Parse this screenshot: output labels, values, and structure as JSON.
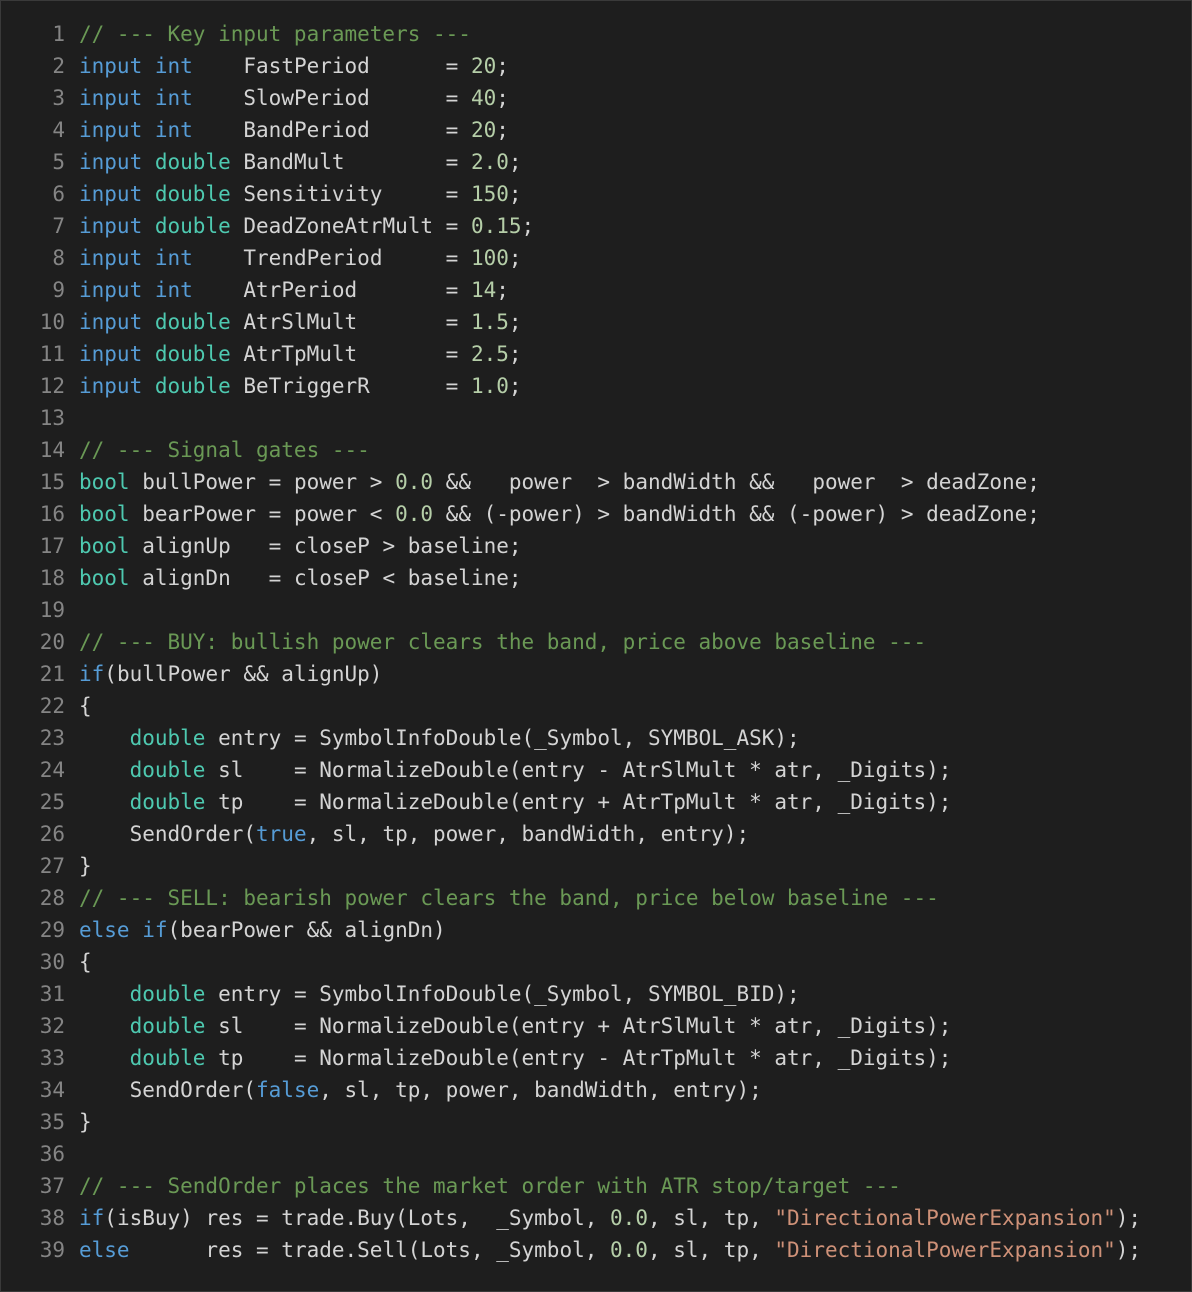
{
  "colors": {
    "background": "#1e1e1e",
    "line_number": "#858585",
    "comment": "#6a9955",
    "keyword": "#569cd6",
    "type": "#4ec9b0",
    "number": "#b5cea8",
    "string": "#ce9178",
    "plain": "#d4d4d4"
  },
  "lines": [
    {
      "number": "1",
      "tokens": [
        {
          "t": "comment",
          "v": "// --- Key input parameters ---"
        }
      ]
    },
    {
      "number": "2",
      "tokens": [
        {
          "t": "keyword",
          "v": "input"
        },
        {
          "t": "plain",
          "v": " "
        },
        {
          "t": "keyword",
          "v": "int"
        },
        {
          "t": "plain",
          "v": "    FastPeriod      = "
        },
        {
          "t": "number",
          "v": "20"
        },
        {
          "t": "plain",
          "v": ";"
        }
      ]
    },
    {
      "number": "3",
      "tokens": [
        {
          "t": "keyword",
          "v": "input"
        },
        {
          "t": "plain",
          "v": " "
        },
        {
          "t": "keyword",
          "v": "int"
        },
        {
          "t": "plain",
          "v": "    SlowPeriod      = "
        },
        {
          "t": "number",
          "v": "40"
        },
        {
          "t": "plain",
          "v": ";"
        }
      ]
    },
    {
      "number": "4",
      "tokens": [
        {
          "t": "keyword",
          "v": "input"
        },
        {
          "t": "plain",
          "v": " "
        },
        {
          "t": "keyword",
          "v": "int"
        },
        {
          "t": "plain",
          "v": "    BandPeriod      = "
        },
        {
          "t": "number",
          "v": "20"
        },
        {
          "t": "plain",
          "v": ";"
        }
      ]
    },
    {
      "number": "5",
      "tokens": [
        {
          "t": "keyword",
          "v": "input"
        },
        {
          "t": "plain",
          "v": " "
        },
        {
          "t": "type",
          "v": "double"
        },
        {
          "t": "plain",
          "v": " BandMult        = "
        },
        {
          "t": "number",
          "v": "2.0"
        },
        {
          "t": "plain",
          "v": ";"
        }
      ]
    },
    {
      "number": "6",
      "tokens": [
        {
          "t": "keyword",
          "v": "input"
        },
        {
          "t": "plain",
          "v": " "
        },
        {
          "t": "type",
          "v": "double"
        },
        {
          "t": "plain",
          "v": " Sensitivity     = "
        },
        {
          "t": "number",
          "v": "150"
        },
        {
          "t": "plain",
          "v": ";"
        }
      ]
    },
    {
      "number": "7",
      "tokens": [
        {
          "t": "keyword",
          "v": "input"
        },
        {
          "t": "plain",
          "v": " "
        },
        {
          "t": "type",
          "v": "double"
        },
        {
          "t": "plain",
          "v": " DeadZoneAtrMult = "
        },
        {
          "t": "number",
          "v": "0.15"
        },
        {
          "t": "plain",
          "v": ";"
        }
      ]
    },
    {
      "number": "8",
      "tokens": [
        {
          "t": "keyword",
          "v": "input"
        },
        {
          "t": "plain",
          "v": " "
        },
        {
          "t": "keyword",
          "v": "int"
        },
        {
          "t": "plain",
          "v": "    TrendPeriod     = "
        },
        {
          "t": "number",
          "v": "100"
        },
        {
          "t": "plain",
          "v": ";"
        }
      ]
    },
    {
      "number": "9",
      "tokens": [
        {
          "t": "keyword",
          "v": "input"
        },
        {
          "t": "plain",
          "v": " "
        },
        {
          "t": "keyword",
          "v": "int"
        },
        {
          "t": "plain",
          "v": "    AtrPeriod       = "
        },
        {
          "t": "number",
          "v": "14"
        },
        {
          "t": "plain",
          "v": ";"
        }
      ]
    },
    {
      "number": "10",
      "tokens": [
        {
          "t": "keyword",
          "v": "input"
        },
        {
          "t": "plain",
          "v": " "
        },
        {
          "t": "type",
          "v": "double"
        },
        {
          "t": "plain",
          "v": " AtrSlMult       = "
        },
        {
          "t": "number",
          "v": "1.5"
        },
        {
          "t": "plain",
          "v": ";"
        }
      ]
    },
    {
      "number": "11",
      "tokens": [
        {
          "t": "keyword",
          "v": "input"
        },
        {
          "t": "plain",
          "v": " "
        },
        {
          "t": "type",
          "v": "double"
        },
        {
          "t": "plain",
          "v": " AtrTpMult       = "
        },
        {
          "t": "number",
          "v": "2.5"
        },
        {
          "t": "plain",
          "v": ";"
        }
      ]
    },
    {
      "number": "12",
      "tokens": [
        {
          "t": "keyword",
          "v": "input"
        },
        {
          "t": "plain",
          "v": " "
        },
        {
          "t": "type",
          "v": "double"
        },
        {
          "t": "plain",
          "v": " BeTriggerR      = "
        },
        {
          "t": "number",
          "v": "1.0"
        },
        {
          "t": "plain",
          "v": ";"
        }
      ]
    },
    {
      "number": "13",
      "tokens": []
    },
    {
      "number": "14",
      "tokens": [
        {
          "t": "comment",
          "v": "// --- Signal gates ---"
        }
      ]
    },
    {
      "number": "15",
      "tokens": [
        {
          "t": "type",
          "v": "bool"
        },
        {
          "t": "plain",
          "v": " bullPower = power > "
        },
        {
          "t": "number",
          "v": "0.0"
        },
        {
          "t": "plain",
          "v": " &&   power  > bandWidth &&   power  > deadZone;"
        }
      ]
    },
    {
      "number": "16",
      "tokens": [
        {
          "t": "type",
          "v": "bool"
        },
        {
          "t": "plain",
          "v": " bearPower = power < "
        },
        {
          "t": "number",
          "v": "0.0"
        },
        {
          "t": "plain",
          "v": " && (-power) > bandWidth && (-power) > deadZone;"
        }
      ]
    },
    {
      "number": "17",
      "tokens": [
        {
          "t": "type",
          "v": "bool"
        },
        {
          "t": "plain",
          "v": " alignUp   = closeP > baseline;"
        }
      ]
    },
    {
      "number": "18",
      "tokens": [
        {
          "t": "type",
          "v": "bool"
        },
        {
          "t": "plain",
          "v": " alignDn   = closeP < baseline;"
        }
      ]
    },
    {
      "number": "19",
      "tokens": []
    },
    {
      "number": "20",
      "tokens": [
        {
          "t": "comment",
          "v": "// --- BUY: bullish power clears the band, price above baseline ---"
        }
      ]
    },
    {
      "number": "21",
      "tokens": [
        {
          "t": "keyword",
          "v": "if"
        },
        {
          "t": "plain",
          "v": "(bullPower && alignUp)"
        }
      ]
    },
    {
      "number": "22",
      "tokens": [
        {
          "t": "plain",
          "v": "{"
        }
      ]
    },
    {
      "number": "23",
      "tokens": [
        {
          "t": "plain",
          "v": "    "
        },
        {
          "t": "type",
          "v": "double"
        },
        {
          "t": "plain",
          "v": " entry = SymbolInfoDouble(_Symbol, SYMBOL_ASK);"
        }
      ]
    },
    {
      "number": "24",
      "tokens": [
        {
          "t": "plain",
          "v": "    "
        },
        {
          "t": "type",
          "v": "double"
        },
        {
          "t": "plain",
          "v": " sl    = NormalizeDouble(entry - AtrSlMult * atr, _Digits);"
        }
      ]
    },
    {
      "number": "25",
      "tokens": [
        {
          "t": "plain",
          "v": "    "
        },
        {
          "t": "type",
          "v": "double"
        },
        {
          "t": "plain",
          "v": " tp    = NormalizeDouble(entry + AtrTpMult * atr, _Digits);"
        }
      ]
    },
    {
      "number": "26",
      "tokens": [
        {
          "t": "plain",
          "v": "    SendOrder("
        },
        {
          "t": "keyword",
          "v": "true"
        },
        {
          "t": "plain",
          "v": ", sl, tp, power, bandWidth, entry);"
        }
      ]
    },
    {
      "number": "27",
      "tokens": [
        {
          "t": "plain",
          "v": "}"
        }
      ]
    },
    {
      "number": "28",
      "tokens": [
        {
          "t": "comment",
          "v": "// --- SELL: bearish power clears the band, price below baseline ---"
        }
      ]
    },
    {
      "number": "29",
      "tokens": [
        {
          "t": "keyword",
          "v": "else"
        },
        {
          "t": "plain",
          "v": " "
        },
        {
          "t": "keyword",
          "v": "if"
        },
        {
          "t": "plain",
          "v": "(bearPower && alignDn)"
        }
      ]
    },
    {
      "number": "30",
      "tokens": [
        {
          "t": "plain",
          "v": "{"
        }
      ]
    },
    {
      "number": "31",
      "tokens": [
        {
          "t": "plain",
          "v": "    "
        },
        {
          "t": "type",
          "v": "double"
        },
        {
          "t": "plain",
          "v": " entry = SymbolInfoDouble(_Symbol, SYMBOL_BID);"
        }
      ]
    },
    {
      "number": "32",
      "tokens": [
        {
          "t": "plain",
          "v": "    "
        },
        {
          "t": "type",
          "v": "double"
        },
        {
          "t": "plain",
          "v": " sl    = NormalizeDouble(entry + AtrSlMult * atr, _Digits);"
        }
      ]
    },
    {
      "number": "33",
      "tokens": [
        {
          "t": "plain",
          "v": "    "
        },
        {
          "t": "type",
          "v": "double"
        },
        {
          "t": "plain",
          "v": " tp    = NormalizeDouble(entry - AtrTpMult * atr, _Digits);"
        }
      ]
    },
    {
      "number": "34",
      "tokens": [
        {
          "t": "plain",
          "v": "    SendOrder("
        },
        {
          "t": "keyword",
          "v": "false"
        },
        {
          "t": "plain",
          "v": ", sl, tp, power, bandWidth, entry);"
        }
      ]
    },
    {
      "number": "35",
      "tokens": [
        {
          "t": "plain",
          "v": "}"
        }
      ]
    },
    {
      "number": "36",
      "tokens": []
    },
    {
      "number": "37",
      "tokens": [
        {
          "t": "comment",
          "v": "// --- SendOrder places the market order with ATR stop/target ---"
        }
      ]
    },
    {
      "number": "38",
      "tokens": [
        {
          "t": "keyword",
          "v": "if"
        },
        {
          "t": "plain",
          "v": "(isBuy) res = trade.Buy(Lots,  _Symbol, "
        },
        {
          "t": "number",
          "v": "0.0"
        },
        {
          "t": "plain",
          "v": ", sl, tp, "
        },
        {
          "t": "string",
          "v": "\"DirectionalPowerExpansion\""
        },
        {
          "t": "plain",
          "v": ");"
        }
      ]
    },
    {
      "number": "39",
      "tokens": [
        {
          "t": "keyword",
          "v": "else"
        },
        {
          "t": "plain",
          "v": "      res = trade.Sell(Lots, _Symbol, "
        },
        {
          "t": "number",
          "v": "0.0"
        },
        {
          "t": "plain",
          "v": ", sl, tp, "
        },
        {
          "t": "string",
          "v": "\"DirectionalPowerExpansion\""
        },
        {
          "t": "plain",
          "v": ");"
        }
      ]
    }
  ]
}
